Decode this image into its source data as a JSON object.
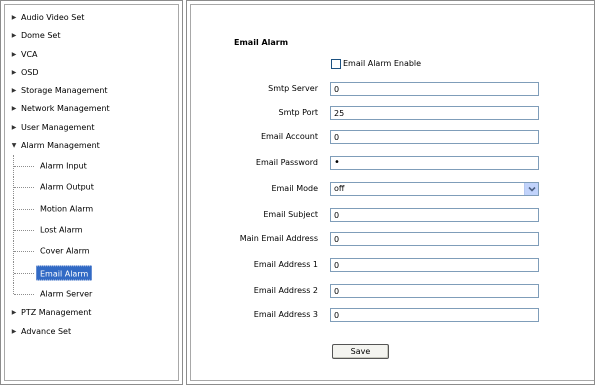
{
  "nav": {
    "items": [
      {
        "label": "Audio Video Set",
        "expanded": false
      },
      {
        "label": "Dome Set",
        "expanded": false
      },
      {
        "label": "VCA",
        "expanded": false
      },
      {
        "label": "OSD",
        "expanded": false
      },
      {
        "label": "Storage Management",
        "expanded": false
      },
      {
        "label": "Network Management",
        "expanded": false
      },
      {
        "label": "User Management",
        "expanded": false
      },
      {
        "label": "Alarm Management",
        "expanded": true
      }
    ],
    "alarm_children": [
      {
        "label": "Alarm Input",
        "selected": false
      },
      {
        "label": "Alarm Output",
        "selected": false
      },
      {
        "label": "Motion Alarm",
        "selected": false
      },
      {
        "label": "Lost Alarm",
        "selected": false
      },
      {
        "label": "Cover Alarm",
        "selected": false
      },
      {
        "label": "Email Alarm",
        "selected": true
      },
      {
        "label": "Alarm Server",
        "selected": false
      }
    ],
    "items_after": [
      {
        "label": "PTZ Management",
        "expanded": false
      },
      {
        "label": "Advance Set",
        "expanded": false
      }
    ],
    "collapsed_icon": "triangle-right-icon",
    "expanded_icon": "triangle-down-icon",
    "selected_color": "#316ac5"
  },
  "form": {
    "title": "Email Alarm",
    "enable_label": "Email Alarm Enable",
    "enable_checked": false,
    "fields": {
      "smtp_server": {
        "label": "Smtp Server",
        "value": "0"
      },
      "smtp_port": {
        "label": "Smtp Port",
        "value": "25"
      },
      "email_account": {
        "label": "Email Account",
        "value": "0"
      },
      "email_password": {
        "label": "Email Password",
        "value": "•"
      },
      "email_mode": {
        "label": "Email Mode",
        "value": "off"
      },
      "email_subject": {
        "label": "Email Subject",
        "value": "0"
      },
      "main_email_address": {
        "label": "Main Email Address",
        "value": "0"
      },
      "email_address_1": {
        "label": "Email Address 1",
        "value": "0"
      },
      "email_address_2": {
        "label": "Email Address 2",
        "value": "0"
      },
      "email_address_3": {
        "label": "Email Address 3",
        "value": "0"
      }
    },
    "save_label": "Save",
    "dropdown_icon": "chevron-down-icon"
  }
}
